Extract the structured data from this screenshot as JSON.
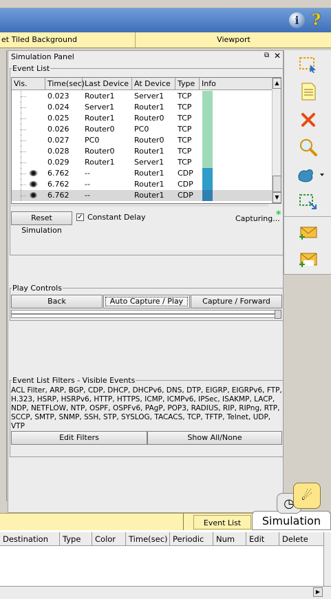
{
  "header": {
    "info_icon": "info-icon",
    "help_icon": "?"
  },
  "topbar": {
    "set_tiled_background": "et Tiled Background",
    "viewport": "Viewport"
  },
  "panel": {
    "title": "Simulation Panel",
    "float_glyph": "⧉",
    "close_glyph": "✕"
  },
  "event_list": {
    "legend": "Event List",
    "columns": [
      "Vis.",
      "Time(sec)",
      "Last Device",
      "At Device",
      "Type",
      "Info"
    ],
    "rows": [
      {
        "vis": "",
        "time": "0.023",
        "last": "Router1",
        "at": "Server1",
        "type": "TCP",
        "color": "#a0dbb7"
      },
      {
        "vis": "",
        "time": "0.024",
        "last": "Server1",
        "at": "Router1",
        "type": "TCP",
        "color": "#a0dbb7"
      },
      {
        "vis": "",
        "time": "0.025",
        "last": "Router1",
        "at": "Router0",
        "type": "TCP",
        "color": "#a0dbb7"
      },
      {
        "vis": "",
        "time": "0.026",
        "last": "Router0",
        "at": "PC0",
        "type": "TCP",
        "color": "#a0dbb7"
      },
      {
        "vis": "",
        "time": "0.027",
        "last": "PC0",
        "at": "Router0",
        "type": "TCP",
        "color": "#a0dbb7"
      },
      {
        "vis": "",
        "time": "0.028",
        "last": "Router0",
        "at": "Router1",
        "type": "TCP",
        "color": "#a0dbb7"
      },
      {
        "vis": "",
        "time": "0.029",
        "last": "Router1",
        "at": "Server1",
        "type": "TCP",
        "color": "#a0dbb7"
      },
      {
        "vis": "eye",
        "time": "6.762",
        "last": "--",
        "at": "Router1",
        "type": "CDP",
        "color": "#2f9cc9"
      },
      {
        "vis": "eye",
        "time": "6.762",
        "last": "--",
        "at": "Router1",
        "type": "CDP",
        "color": "#2f9cc9"
      },
      {
        "vis": "eye",
        "time": "6.762",
        "last": "--",
        "at": "Router1",
        "type": "CDP",
        "color": "#2f80b0",
        "selected": true
      }
    ],
    "reset_label": "Reset Simulation",
    "constant_delay_label": "Constant Delay",
    "constant_delay_checked": true,
    "check_glyph": "✓",
    "capturing_label": "Capturing...",
    "capture_star": "*"
  },
  "play_controls": {
    "legend": "Play Controls",
    "back_label": "Back",
    "auto_label": "Auto Capture / Play",
    "capture_forward_label": "Capture / Forward"
  },
  "filters": {
    "legend": "Event List Filters - Visible Events",
    "text": "ACL Filter, ARP, BGP, CDP, DHCP, DHCPv6, DNS, DTP, EIGRP, EIGRPv6, FTP, H.323, HSRP, HSRPv6, HTTP, HTTPS, ICMP, ICMPv6, IPSec, ISAKMP, LACP, NDP, NETFLOW, NTP, OSPF, OSPFv6, PAgP, POP3, RADIUS, RIP, RIPng, RTP, SCCP, SMTP, SNMP, SSH, STP, SYSLOG, TACACS, TCP, TFTP, Telnet, UDP, VTP",
    "edit_label": "Edit Filters",
    "show_all_label": "Show All/None"
  },
  "toolbar": {
    "icons": [
      "select-icon",
      "note-icon",
      "delete-icon",
      "inspect-icon",
      "draw-shape-icon",
      "resize-icon",
      "add-simple-pdu-icon",
      "add-complex-pdu-icon"
    ]
  },
  "bottom_tabs": {
    "event_list": "Event List",
    "simulation": "Simulation"
  },
  "pdu_table": {
    "columns": [
      "Destination",
      "Type",
      "Color",
      "Time(sec)",
      "Periodic",
      "Num",
      "Edit",
      "Delete"
    ]
  },
  "colors": {
    "accent_blue": "#3f6fb8",
    "yellow_bar": "#fdf2b0",
    "tcp_green": "#a0dbb7",
    "cdp_blue": "#2f9cc9"
  }
}
